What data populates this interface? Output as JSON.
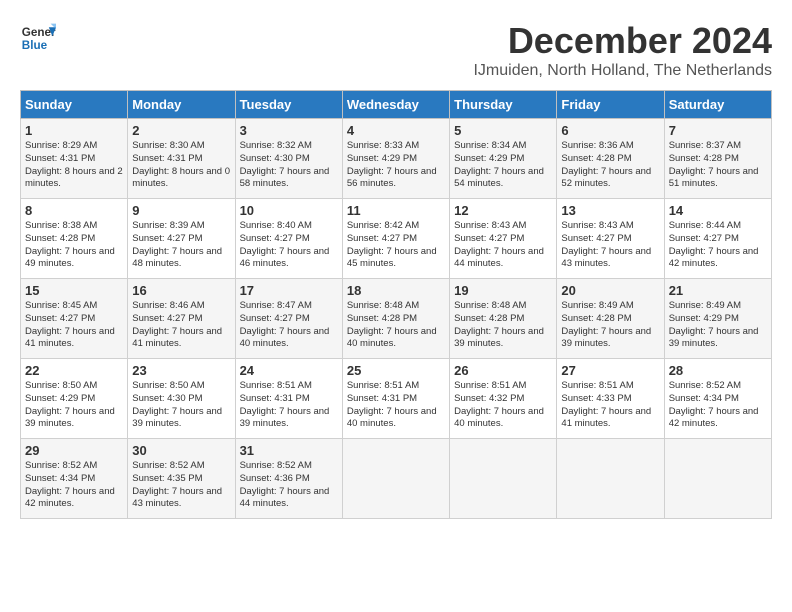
{
  "logo": {
    "line1": "General",
    "line2": "Blue"
  },
  "title": "December 2024",
  "subtitle": "IJmuiden, North Holland, The Netherlands",
  "headers": [
    "Sunday",
    "Monday",
    "Tuesday",
    "Wednesday",
    "Thursday",
    "Friday",
    "Saturday"
  ],
  "weeks": [
    [
      {
        "day": "1",
        "sunrise": "8:29 AM",
        "sunset": "4:31 PM",
        "daylight": "8 hours and 2 minutes."
      },
      {
        "day": "2",
        "sunrise": "8:30 AM",
        "sunset": "4:31 PM",
        "daylight": "8 hours and 0 minutes."
      },
      {
        "day": "3",
        "sunrise": "8:32 AM",
        "sunset": "4:30 PM",
        "daylight": "7 hours and 58 minutes."
      },
      {
        "day": "4",
        "sunrise": "8:33 AM",
        "sunset": "4:29 PM",
        "daylight": "7 hours and 56 minutes."
      },
      {
        "day": "5",
        "sunrise": "8:34 AM",
        "sunset": "4:29 PM",
        "daylight": "7 hours and 54 minutes."
      },
      {
        "day": "6",
        "sunrise": "8:36 AM",
        "sunset": "4:28 PM",
        "daylight": "7 hours and 52 minutes."
      },
      {
        "day": "7",
        "sunrise": "8:37 AM",
        "sunset": "4:28 PM",
        "daylight": "7 hours and 51 minutes."
      }
    ],
    [
      {
        "day": "8",
        "sunrise": "8:38 AM",
        "sunset": "4:28 PM",
        "daylight": "7 hours and 49 minutes."
      },
      {
        "day": "9",
        "sunrise": "8:39 AM",
        "sunset": "4:27 PM",
        "daylight": "7 hours and 48 minutes."
      },
      {
        "day": "10",
        "sunrise": "8:40 AM",
        "sunset": "4:27 PM",
        "daylight": "7 hours and 46 minutes."
      },
      {
        "day": "11",
        "sunrise": "8:42 AM",
        "sunset": "4:27 PM",
        "daylight": "7 hours and 45 minutes."
      },
      {
        "day": "12",
        "sunrise": "8:43 AM",
        "sunset": "4:27 PM",
        "daylight": "7 hours and 44 minutes."
      },
      {
        "day": "13",
        "sunrise": "8:43 AM",
        "sunset": "4:27 PM",
        "daylight": "7 hours and 43 minutes."
      },
      {
        "day": "14",
        "sunrise": "8:44 AM",
        "sunset": "4:27 PM",
        "daylight": "7 hours and 42 minutes."
      }
    ],
    [
      {
        "day": "15",
        "sunrise": "8:45 AM",
        "sunset": "4:27 PM",
        "daylight": "7 hours and 41 minutes."
      },
      {
        "day": "16",
        "sunrise": "8:46 AM",
        "sunset": "4:27 PM",
        "daylight": "7 hours and 41 minutes."
      },
      {
        "day": "17",
        "sunrise": "8:47 AM",
        "sunset": "4:27 PM",
        "daylight": "7 hours and 40 minutes."
      },
      {
        "day": "18",
        "sunrise": "8:48 AM",
        "sunset": "4:28 PM",
        "daylight": "7 hours and 40 minutes."
      },
      {
        "day": "19",
        "sunrise": "8:48 AM",
        "sunset": "4:28 PM",
        "daylight": "7 hours and 39 minutes."
      },
      {
        "day": "20",
        "sunrise": "8:49 AM",
        "sunset": "4:28 PM",
        "daylight": "7 hours and 39 minutes."
      },
      {
        "day": "21",
        "sunrise": "8:49 AM",
        "sunset": "4:29 PM",
        "daylight": "7 hours and 39 minutes."
      }
    ],
    [
      {
        "day": "22",
        "sunrise": "8:50 AM",
        "sunset": "4:29 PM",
        "daylight": "7 hours and 39 minutes."
      },
      {
        "day": "23",
        "sunrise": "8:50 AM",
        "sunset": "4:30 PM",
        "daylight": "7 hours and 39 minutes."
      },
      {
        "day": "24",
        "sunrise": "8:51 AM",
        "sunset": "4:31 PM",
        "daylight": "7 hours and 39 minutes."
      },
      {
        "day": "25",
        "sunrise": "8:51 AM",
        "sunset": "4:31 PM",
        "daylight": "7 hours and 40 minutes."
      },
      {
        "day": "26",
        "sunrise": "8:51 AM",
        "sunset": "4:32 PM",
        "daylight": "7 hours and 40 minutes."
      },
      {
        "day": "27",
        "sunrise": "8:51 AM",
        "sunset": "4:33 PM",
        "daylight": "7 hours and 41 minutes."
      },
      {
        "day": "28",
        "sunrise": "8:52 AM",
        "sunset": "4:34 PM",
        "daylight": "7 hours and 42 minutes."
      }
    ],
    [
      {
        "day": "29",
        "sunrise": "8:52 AM",
        "sunset": "4:34 PM",
        "daylight": "7 hours and 42 minutes."
      },
      {
        "day": "30",
        "sunrise": "8:52 AM",
        "sunset": "4:35 PM",
        "daylight": "7 hours and 43 minutes."
      },
      {
        "day": "31",
        "sunrise": "8:52 AM",
        "sunset": "4:36 PM",
        "daylight": "7 hours and 44 minutes."
      },
      {
        "day": "",
        "sunrise": "",
        "sunset": "",
        "daylight": ""
      },
      {
        "day": "",
        "sunrise": "",
        "sunset": "",
        "daylight": ""
      },
      {
        "day": "",
        "sunrise": "",
        "sunset": "",
        "daylight": ""
      },
      {
        "day": "",
        "sunrise": "",
        "sunset": "",
        "daylight": ""
      }
    ]
  ],
  "labels": {
    "sunrise": "Sunrise:",
    "sunset": "Sunset:",
    "daylight": "Daylight:"
  }
}
